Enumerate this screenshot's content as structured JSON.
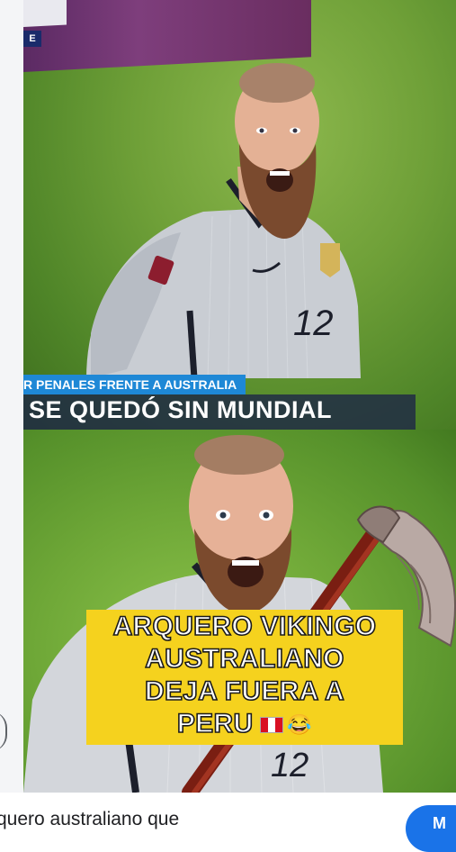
{
  "media": {
    "top_panel": {
      "board_badge": "E",
      "ticker": "R PENALES FRENTE A AUSTRALIA",
      "headline": "SE QUEDÓ SIN MUNDIAL"
    },
    "bottom_panel": {
      "caption_lines": [
        "ARQUERO VIKINGO",
        "AUSTRALIANO",
        "DEJA FUERA A",
        "PERU"
      ],
      "caption_emojis": [
        "🇵🇪",
        "😂"
      ]
    }
  },
  "footer": {
    "snippet": "quero australiano que",
    "button_label": "M"
  },
  "colors": {
    "ticker": "#1e88d6",
    "caption_box": "#f5d21e",
    "button": "#1a73e8"
  },
  "icons": [
    "player-photo",
    "player-with-axe-photo",
    "peru-flag-icon",
    "laughing-face-icon"
  ]
}
